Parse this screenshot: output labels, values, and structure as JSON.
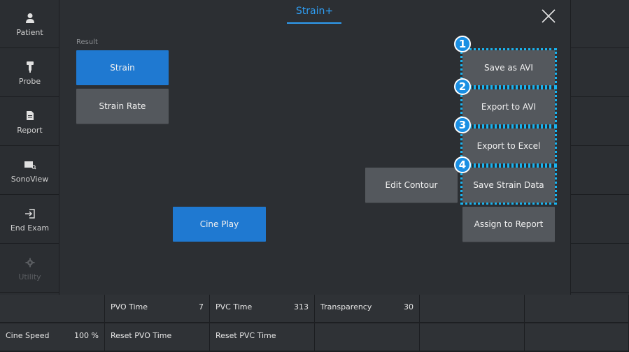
{
  "sidebar": {
    "items": [
      {
        "label": "Patient",
        "icon": "person-icon"
      },
      {
        "label": "Probe",
        "icon": "probe-icon"
      },
      {
        "label": "Report",
        "icon": "report-icon"
      },
      {
        "label": "SonoView",
        "icon": "sonoview-icon"
      },
      {
        "label": "End Exam",
        "icon": "end-exam-icon"
      },
      {
        "label": "Utility",
        "icon": "gear-icon",
        "disabled": true
      }
    ]
  },
  "header": {
    "title": "Strain+"
  },
  "result": {
    "label": "Result",
    "strain": "Strain",
    "strain_rate": "Strain Rate"
  },
  "actions": {
    "save_avi": "Save as AVI",
    "export_avi": "Export to AVI",
    "export_excel": "Export to Excel",
    "save_strain": "Save Strain Data",
    "assign_report": "Assign to Report",
    "edit_contour": "Edit Contour",
    "cine_play": "Cine Play"
  },
  "badges": [
    "1",
    "2",
    "3",
    "4"
  ],
  "bottom": {
    "pvo_time_label": "PVO Time",
    "pvo_time_value": "7",
    "pvc_time_label": "PVC Time",
    "pvc_time_value": "313",
    "transparency_label": "Transparency",
    "transparency_value": "30",
    "cine_speed_label": "Cine Speed",
    "cine_speed_value": "100 %",
    "reset_pvo": "Reset PVO Time",
    "reset_pvc": "Reset PVC Time"
  },
  "colors": {
    "accent": "#2f9df2",
    "selected": "#1f79d1",
    "highlight": "#19b4f0"
  }
}
